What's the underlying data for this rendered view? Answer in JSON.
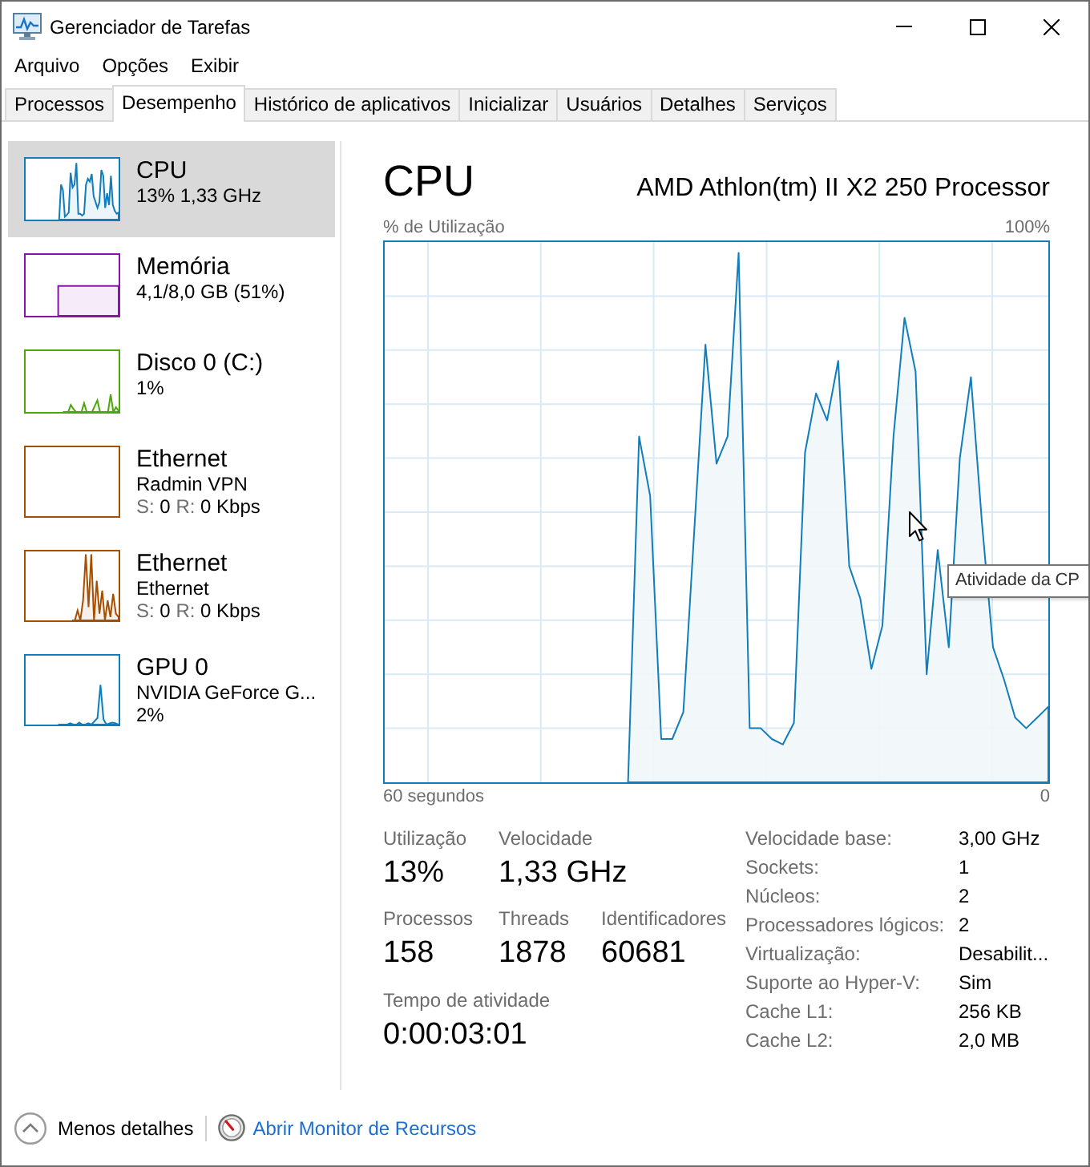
{
  "window": {
    "title": "Gerenciador de Tarefas"
  },
  "menu": [
    "Arquivo",
    "Opções",
    "Exibir"
  ],
  "tabs": [
    {
      "label": "Processos",
      "selected": false
    },
    {
      "label": "Desempenho",
      "selected": true
    },
    {
      "label": "Histórico de aplicativos",
      "selected": false
    },
    {
      "label": "Inicializar",
      "selected": false
    },
    {
      "label": "Usuários",
      "selected": false
    },
    {
      "label": "Detalhes",
      "selected": false
    },
    {
      "label": "Serviços",
      "selected": false
    }
  ],
  "sidebar": {
    "items": [
      {
        "title": "CPU",
        "lines": [
          "13% 1,33 GHz"
        ],
        "color": "#117dbb",
        "selected": true
      },
      {
        "title": "Memória",
        "lines": [
          "4,1/8,0 GB (51%)"
        ],
        "color": "#8b12ae",
        "selected": false
      },
      {
        "title": "Disco 0 (C:)",
        "lines": [
          "1%"
        ],
        "color": "#4da60c",
        "selected": false
      },
      {
        "title": "Ethernet",
        "lines": [
          "Radmin VPN"
        ],
        "throughput": {
          "send_label": "S:",
          "send": "0",
          "receive_label": "R:",
          "receive": "0 Kbps"
        },
        "color": "#a74f01",
        "selected": false
      },
      {
        "title": "Ethernet",
        "lines": [
          "Ethernet"
        ],
        "throughput": {
          "send_label": "S:",
          "send": "0",
          "receive_label": "R:",
          "receive": "0 Kbps"
        },
        "color": "#a74f01",
        "selected": false
      },
      {
        "title": "GPU 0",
        "lines": [
          "NVIDIA GeForce G...",
          "2%"
        ],
        "color": "#117dbb",
        "selected": false
      }
    ]
  },
  "detail": {
    "title": "CPU",
    "device": "AMD Athlon(tm) II X2 250 Processor",
    "graph": {
      "y_label": "% de Utilização",
      "y_max_label": "100%",
      "x_start_label": "60 segundos",
      "x_end_label": "0",
      "tooltip": "Atividade da CP"
    },
    "stat_rows": [
      [
        {
          "label": "Utilização",
          "value": "13%"
        },
        {
          "label": "Velocidade",
          "value": "1,33 GHz"
        }
      ],
      [
        {
          "label": "Processos",
          "value": "158"
        },
        {
          "label": "Threads",
          "value": "1878"
        },
        {
          "label": "Identificadores",
          "value": "60681"
        }
      ],
      [
        {
          "label": "Tempo de atividade",
          "value": "0:00:03:01"
        }
      ]
    ],
    "properties": [
      {
        "label": "Velocidade base:",
        "value": "3,00 GHz"
      },
      {
        "label": "Sockets:",
        "value": "1"
      },
      {
        "label": "Núcleos:",
        "value": "2"
      },
      {
        "label": "Processadores lógicos:",
        "value": "2"
      },
      {
        "label": "Virtualização:",
        "value": "Desabilit..."
      },
      {
        "label": "Suporte ao Hyper-V:",
        "value": "Sim"
      },
      {
        "label": "Cache L1:",
        "value": "256 KB"
      },
      {
        "label": "Cache L2:",
        "value": "2,0 MB"
      }
    ]
  },
  "footer": {
    "details_toggle": "Menos detalhes",
    "link": "Abrir Monitor de Recursos"
  }
}
